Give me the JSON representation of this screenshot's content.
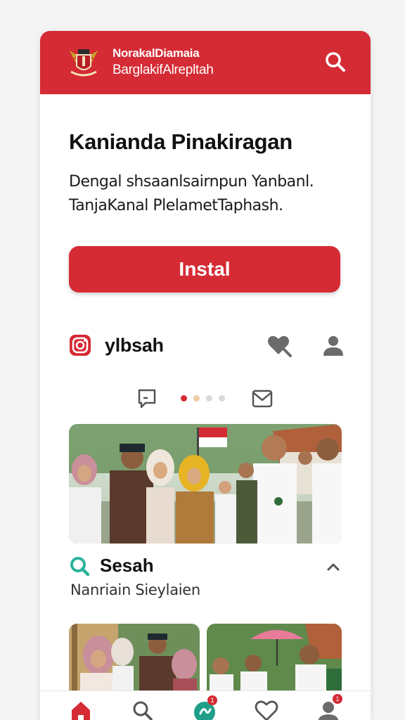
{
  "header": {
    "brand_line1": "NorakalDiamaia",
    "brand_line2": "BarglakifAlrepltah",
    "accent_color": "#d52b35",
    "logo_icon": "garuda-emblem-icon",
    "search_icon": "search-icon"
  },
  "hero": {
    "title": "Kanianda Pinakiragan",
    "description_line1": "Dengal shsaanlsairnpun Yanbanl.",
    "description_line2": "TanjaKanal PlelametTaphash.",
    "install_label": "Instal"
  },
  "profile_row": {
    "platform_icon": "instagram-icon",
    "username": "ylbsah",
    "actions": [
      "heart-icon",
      "user-icon"
    ]
  },
  "carousel": {
    "left_icon": "chat-icon",
    "right_icon": "mail-icon",
    "dot_count": 4,
    "active_dot": 0,
    "dot_colors": [
      "#d52b35",
      "#f0c9a6",
      "#d9d9d9",
      "#d9d9d9"
    ]
  },
  "section": {
    "icon": "search-icon",
    "title": "Sesah",
    "subtitle": "Nanriain Sieylaien",
    "chevron": "chevron-up-icon"
  },
  "bottom_nav": {
    "items": [
      {
        "icon": "home-icon",
        "active": true
      },
      {
        "icon": "search-icon",
        "active": false
      },
      {
        "icon": "activity-icon",
        "active": false,
        "badge": "1"
      },
      {
        "icon": "heart-icon",
        "active": false
      },
      {
        "icon": "user-icon",
        "active": false,
        "badge": "1"
      }
    ]
  }
}
